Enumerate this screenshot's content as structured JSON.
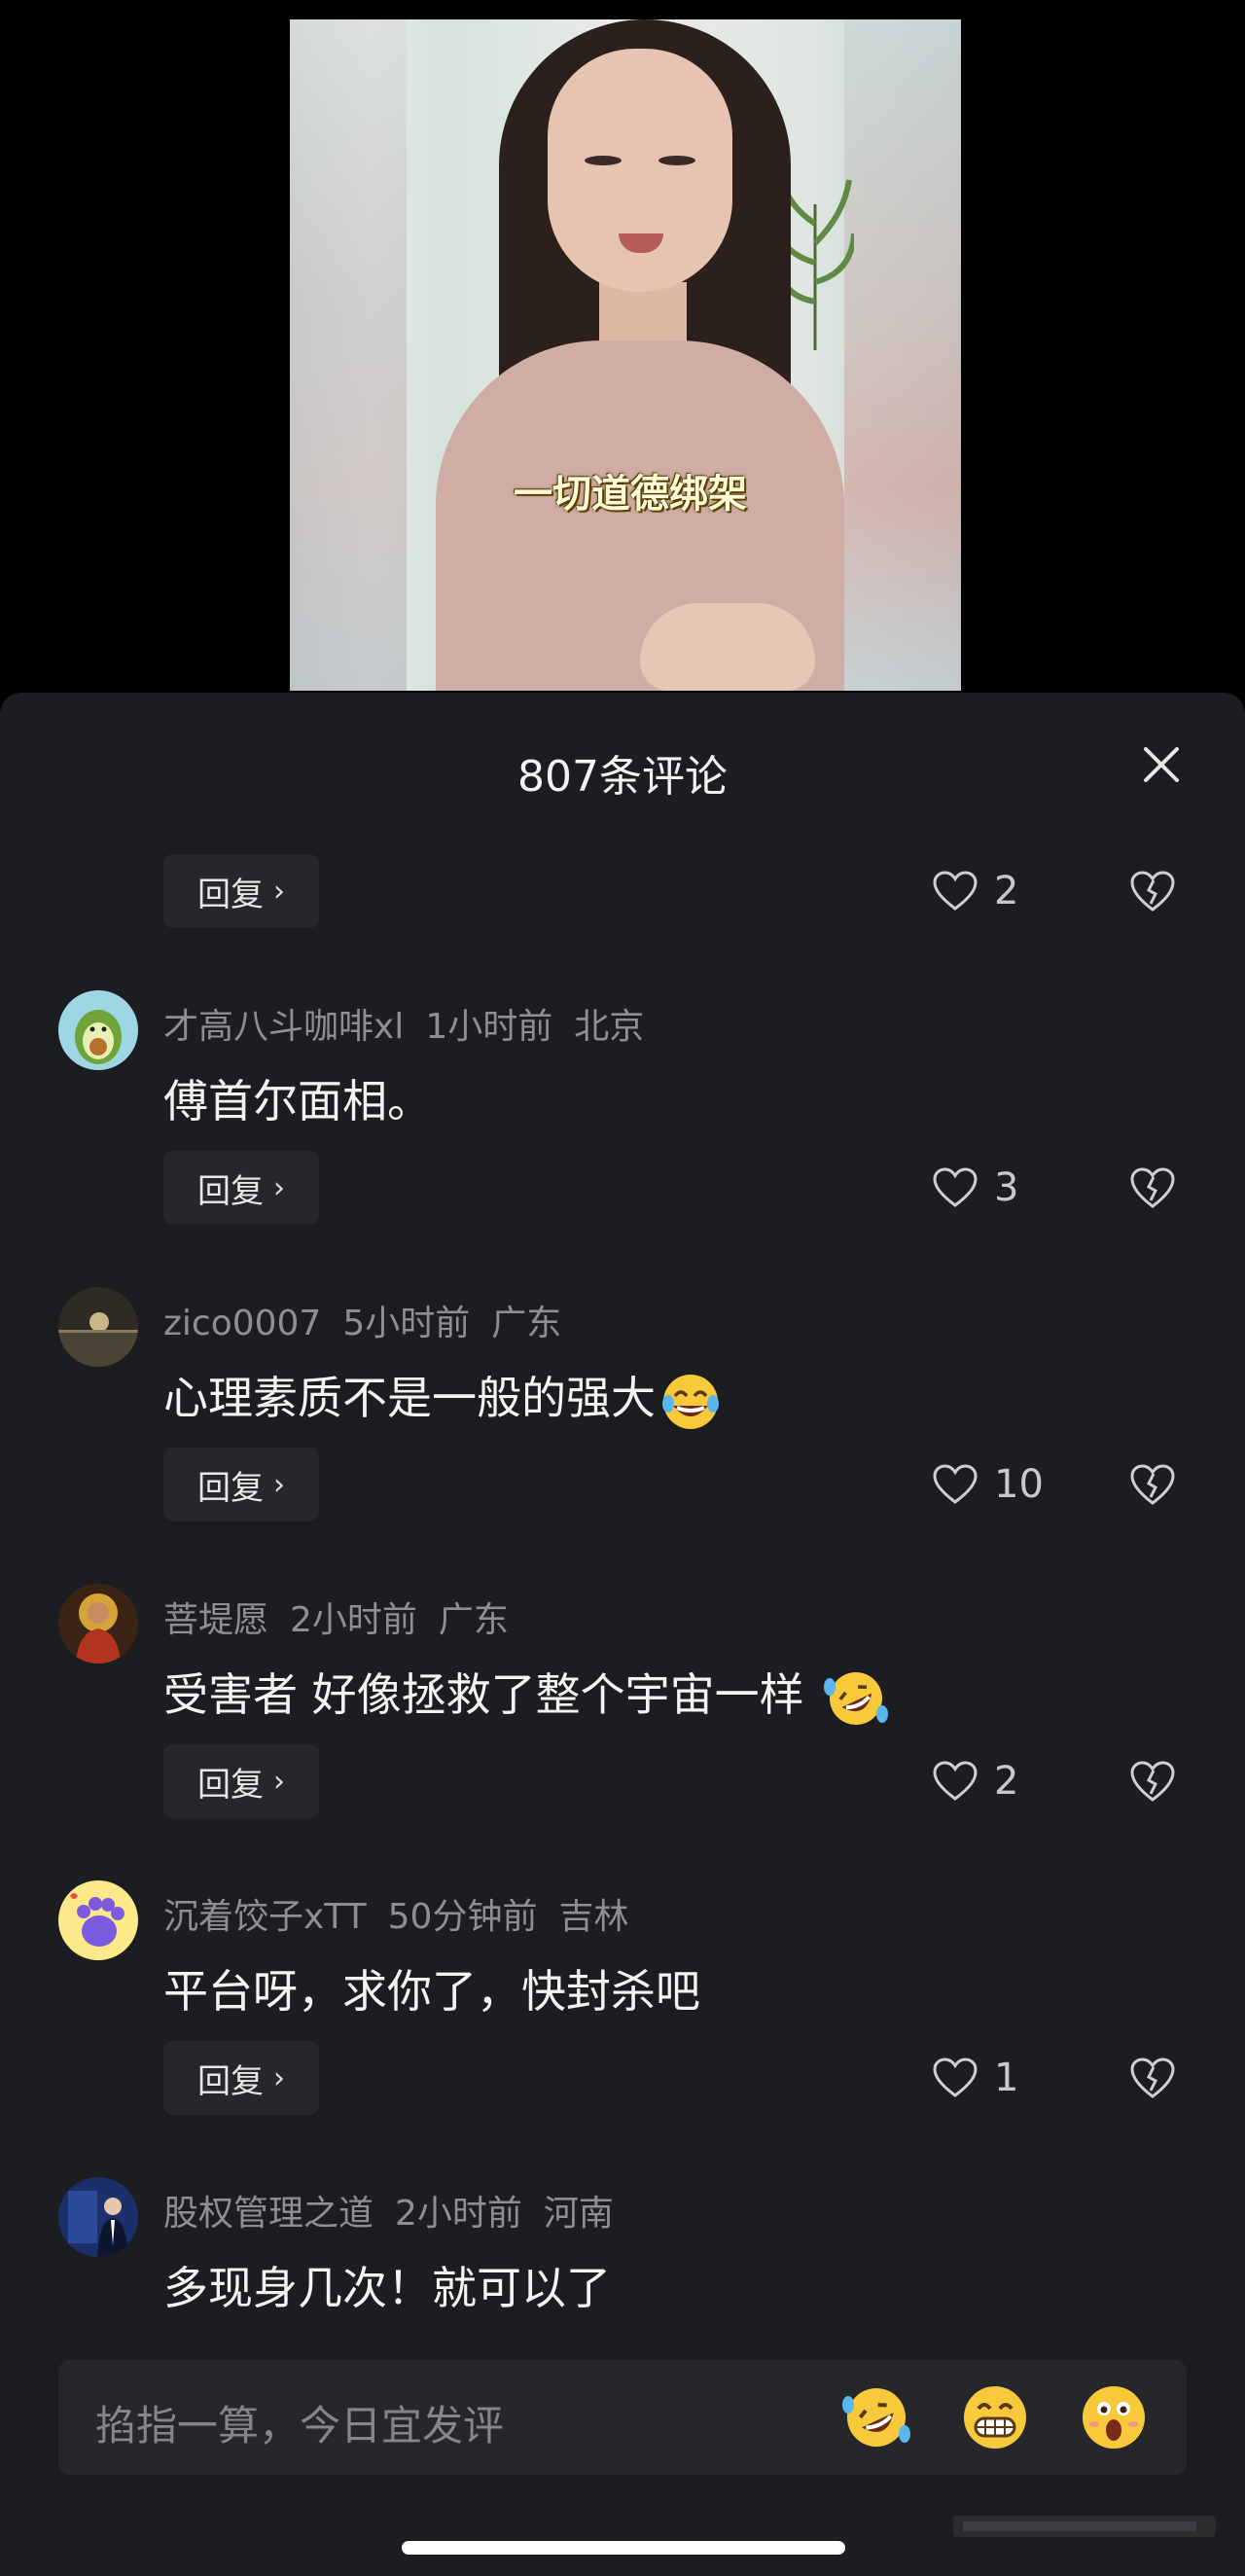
{
  "video": {
    "subtitle": "一切道德绑架"
  },
  "comments_header": {
    "title": "807条评论"
  },
  "top_row": {
    "reply_label": "回复",
    "likes": "2"
  },
  "comments": [
    {
      "username": "才高八斗咖啡xl",
      "time": "1小时前",
      "location": "北京",
      "text": "傅首尔面相。",
      "reply_label": "回复",
      "likes": "3",
      "emoji": ""
    },
    {
      "username": "zico0007",
      "time": "5小时前",
      "location": "广东",
      "text": "心理素质不是一般的强大",
      "reply_label": "回复",
      "likes": "10",
      "emoji": "tears-of-joy"
    },
    {
      "username": "菩堤愿",
      "time": "2小时前",
      "location": "广东",
      "text": "受害者 好像拯救了整个宇宙一样 ",
      "reply_label": "回复",
      "likes": "2",
      "emoji": "rolling-laugh"
    },
    {
      "username": "沉着饺子xTT",
      "time": "50分钟前",
      "location": "吉林",
      "text": "平台呀，求你了，快封杀吧",
      "reply_label": "回复",
      "likes": "1",
      "emoji": ""
    },
    {
      "username": "股权管理之道",
      "time": "2小时前",
      "location": "河南",
      "text": "多现身几次！就可以了"
    }
  ],
  "input": {
    "placeholder": "掐指一算，今日宜发评"
  },
  "icons": [
    "close-icon",
    "heart-icon",
    "broken-heart-icon",
    "chevron-right-icon",
    "rolling-laugh-emoji",
    "grin-emoji",
    "surprised-emoji"
  ]
}
